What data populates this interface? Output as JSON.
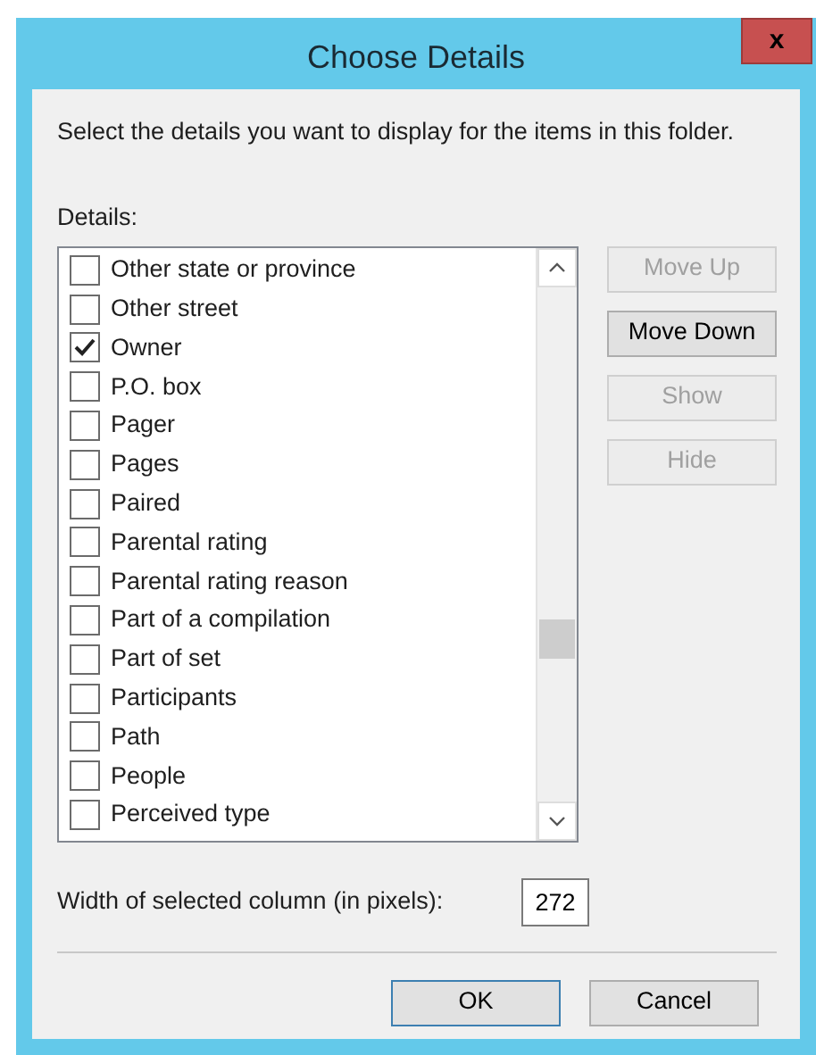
{
  "window": {
    "title": "Choose Details",
    "close": "x"
  },
  "instruction": "Select the details you want to display for the items in this folder.",
  "details_label": "Details:",
  "details": [
    {
      "label": "Other state or province",
      "checked": false
    },
    {
      "label": "Other street",
      "checked": false
    },
    {
      "label": "Owner",
      "checked": true
    },
    {
      "label": "P.O. box",
      "checked": false
    },
    {
      "label": "Pager",
      "checked": false
    },
    {
      "label": "Pages",
      "checked": false
    },
    {
      "label": "Paired",
      "checked": false
    },
    {
      "label": "Parental rating",
      "checked": false
    },
    {
      "label": "Parental rating reason",
      "checked": false
    },
    {
      "label": "Part of a compilation",
      "checked": false
    },
    {
      "label": "Part of set",
      "checked": false
    },
    {
      "label": "Participants",
      "checked": false
    },
    {
      "label": "Path",
      "checked": false
    },
    {
      "label": "People",
      "checked": false
    },
    {
      "label": "Perceived type",
      "checked": false
    }
  ],
  "side_buttons": [
    {
      "label": "Move Up",
      "disabled": true
    },
    {
      "label": "Move Down",
      "disabled": false
    },
    {
      "label": "Show",
      "disabled": true
    },
    {
      "label": "Hide",
      "disabled": true
    }
  ],
  "width_label": "Width of selected column (in pixels):",
  "width_value": "272",
  "buttons": [
    {
      "label": "OK",
      "default": true
    },
    {
      "label": "Cancel",
      "default": false
    }
  ]
}
